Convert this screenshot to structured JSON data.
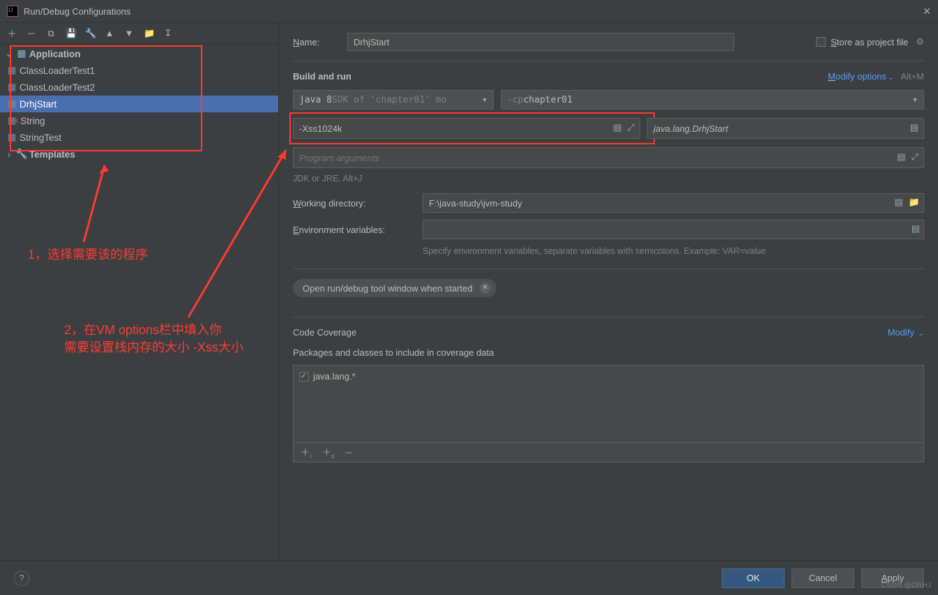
{
  "title": "Run/Debug Configurations",
  "store_label": "Store as project file",
  "tree": {
    "app_label": "Application",
    "items": [
      "ClassLoaderTest1",
      "ClassLoaderTest2",
      "DrhjStart",
      "String",
      "StringTest"
    ],
    "templates_label": "Templates"
  },
  "form": {
    "name_label": "Name:",
    "name_value": "DrhjStart",
    "build_run": "Build and run",
    "modify_options": "Modify options",
    "modify_short": "Alt+M",
    "jdk_prefix": "java 8",
    "jdk_hint": " SDK of 'chapter01' mo",
    "cp_prefix": "-cp ",
    "cp_value": "chapter01",
    "vm_value": "-Xss1024k",
    "main_class": "java.lang.DrhjStart",
    "prog_args_placeholder": "Program arguments",
    "jdk_hint_text": "JDK or JRE. Alt+J",
    "wd_label": "Working directory:",
    "wd_value": "F:\\java-study\\jvm-study",
    "env_label": "Environment variables:",
    "env_hint": "Specify environment variables, separate variables with semicolons. Example: VAR=value",
    "open_tool": "Open run/debug tool window when started",
    "code_coverage": "Code Coverage",
    "cc_modify": "Modify",
    "cc_sub": "Packages and classes to include in coverage data",
    "cc_item": "java.lang.*"
  },
  "footer": {
    "ok": "OK",
    "cancel": "Cancel",
    "apply": "Apply"
  },
  "annotations": {
    "a1": "1，选择需要该的程序",
    "a2": "2，在VM options栏中填入你\n需要设置栈内存的大小 -Xss大小"
  },
  "watermark": "CSDN @DRHJ"
}
